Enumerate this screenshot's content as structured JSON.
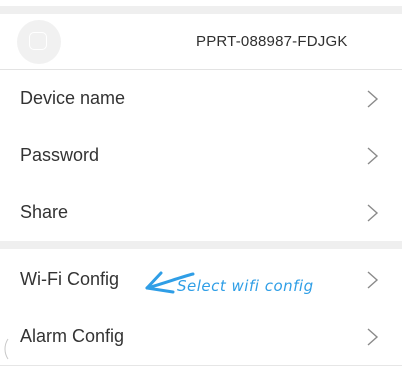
{
  "device": {
    "id": "PPRT-088987-FDJGK",
    "avatar_icon": "camera-device-icon"
  },
  "menu": {
    "items": [
      {
        "label": "Device name",
        "icon": "chevron-right-icon"
      },
      {
        "label": "Password",
        "icon": "chevron-right-icon"
      },
      {
        "label": "Share",
        "icon": "chevron-right-icon"
      },
      {
        "label": "Wi-Fi Config",
        "icon": "chevron-right-icon"
      },
      {
        "label": "Alarm Config",
        "icon": "chevron-right-icon"
      }
    ]
  },
  "annotation": {
    "text": "Select wifi config",
    "color": "#2f9ee6"
  },
  "colors": {
    "background": "#ffffff",
    "separator_band": "#efefef",
    "text": "#333333"
  }
}
